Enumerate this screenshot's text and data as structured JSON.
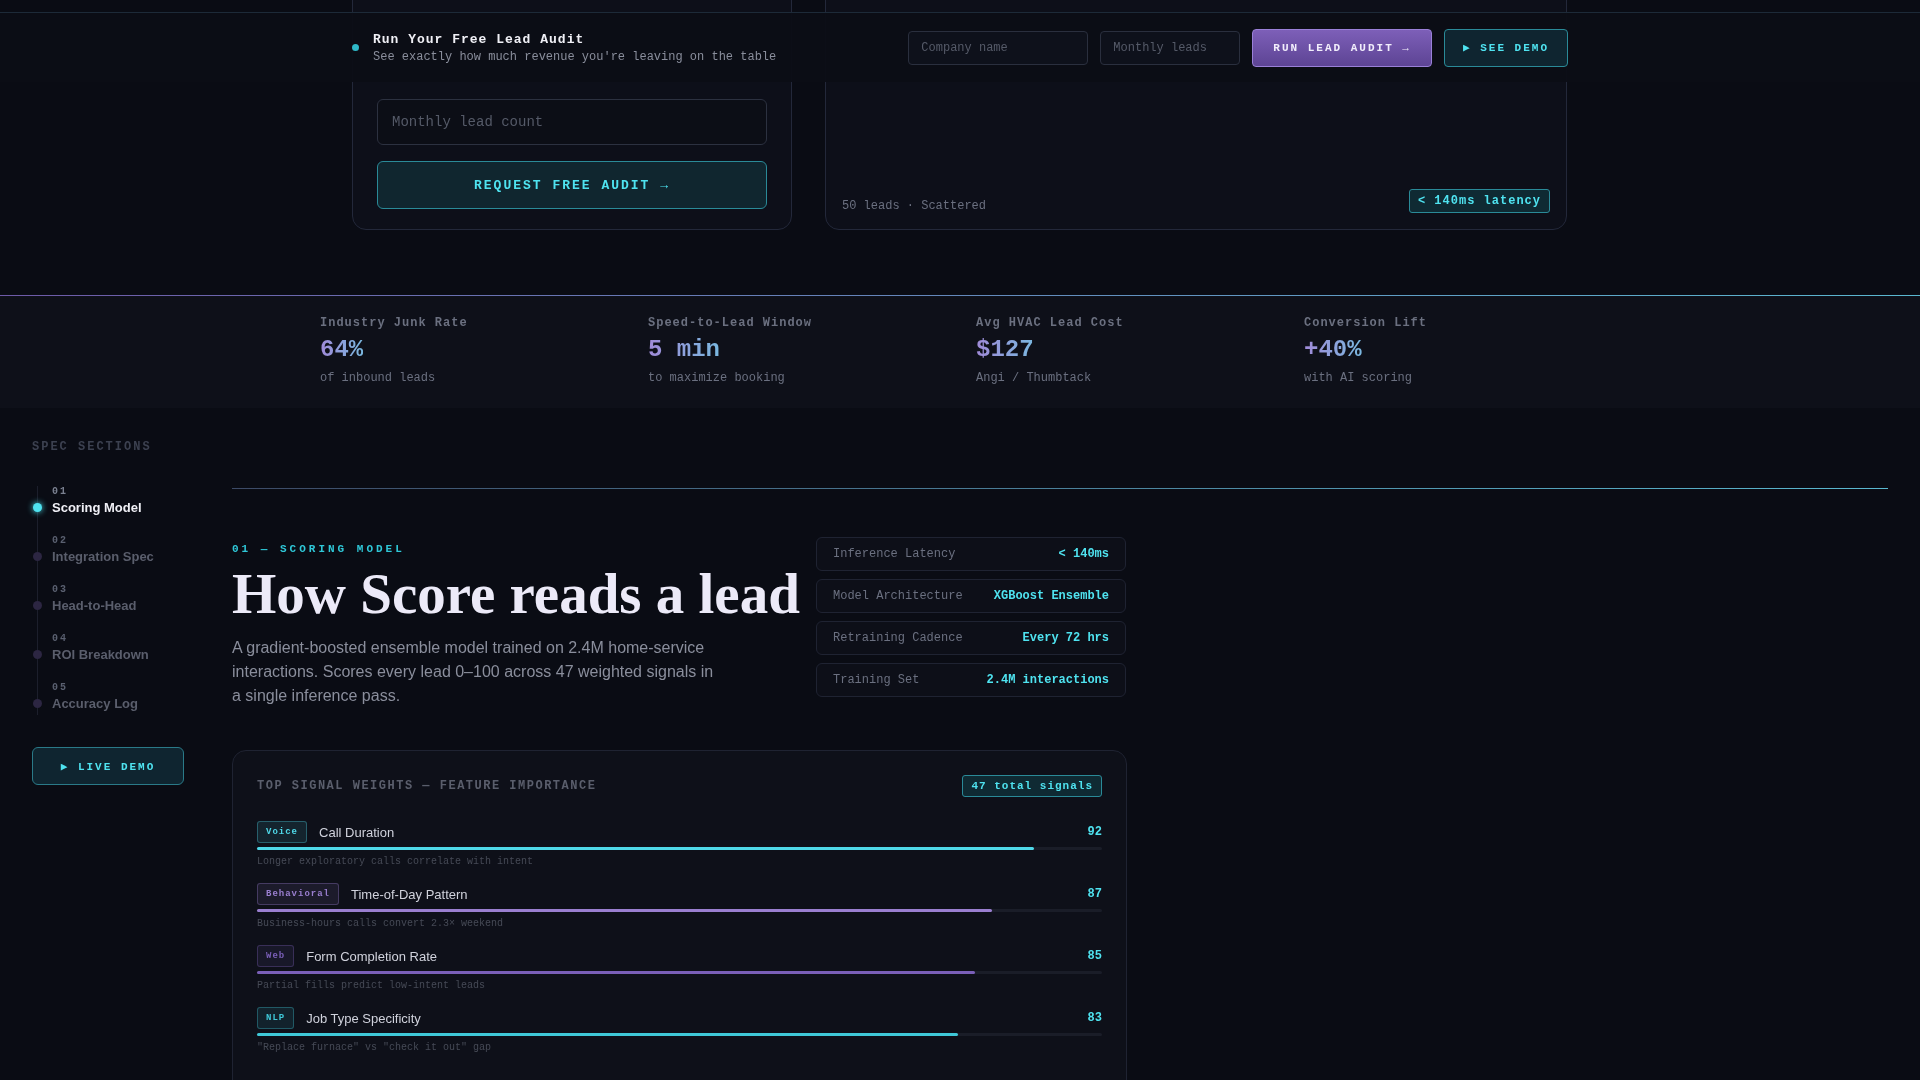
{
  "top_bar": {
    "title": "Run Your Free Lead Audit",
    "subtitle": "See exactly how much revenue you're leaving on the table",
    "fields": [
      {
        "placeholder": "Company name"
      },
      {
        "placeholder": "Monthly leads"
      }
    ],
    "primary_button": "RUN LEAD AUDIT →",
    "secondary_button": "▶ SEE DEMO"
  },
  "audit_card": {
    "field": {
      "placeholder": "Monthly lead count"
    },
    "button": "REQUEST FREE AUDIT →"
  },
  "preview_card": {
    "caption": "50 leads · Scattered",
    "badge": "< 140ms latency"
  },
  "stats": [
    {
      "label": "Industry Junk Rate",
      "value": "64%",
      "note": "of inbound leads"
    },
    {
      "label": "Speed-to-Lead Window",
      "value": "5 min",
      "note": "to maximize booking"
    },
    {
      "label": "Avg HVAC Lead Cost",
      "value": "$127",
      "note": "Angi / Thumbtack"
    },
    {
      "label": "Conversion Lift",
      "value": "+40%",
      "note": "with AI scoring"
    }
  ],
  "sidebar": {
    "title": "SPEC SECTIONS",
    "items": [
      {
        "number": "01",
        "label": "Scoring Model",
        "selected": true
      },
      {
        "number": "02",
        "label": "Integration Spec",
        "selected": false
      },
      {
        "number": "03",
        "label": "Head-to-Head",
        "selected": false
      },
      {
        "number": "04",
        "label": "ROI Breakdown",
        "selected": false
      },
      {
        "number": "05",
        "label": "Accuracy Log",
        "selected": false
      }
    ],
    "button": "▶ LIVE DEMO"
  },
  "section": {
    "eyebrow": "01 — SCORING MODEL",
    "heading": "How Score reads a lead",
    "description": "A gradient-boosted ensemble model trained on 2.4M home-service interactions. Scores every lead 0–100 across 47 weighted signals in a single inference pass.",
    "specs": [
      {
        "label": "Inference Latency",
        "value": "< 140ms"
      },
      {
        "label": "Model Architecture",
        "value": "XGBoost Ensemble"
      },
      {
        "label": "Retraining Cadence",
        "value": "Every 72 hrs"
      },
      {
        "label": "Training Set",
        "value": "2.4M interactions"
      }
    ]
  },
  "signals": {
    "title": "TOP SIGNAL WEIGHTS — FEATURE IMPORTANCE",
    "badge": "47 total signals",
    "items": [
      {
        "tag": "Voice",
        "name": "Call Duration",
        "score": "92",
        "level": 0.92,
        "color": "#4fd8e8",
        "note": "Longer exploratory calls correlate with intent"
      },
      {
        "tag": "Behavioral",
        "name": "Time-of-Day Pattern",
        "score": "87",
        "level": 0.87,
        "color": "#9a7fd0",
        "note": "Business-hours calls convert 2.3× weekend"
      },
      {
        "tag": "Web",
        "name": "Form Completion Rate",
        "score": "85",
        "level": 0.85,
        "color": "#7a5fb8",
        "note": "Partial fills predict low-intent leads"
      },
      {
        "tag": "NLP",
        "name": "Job Type Specificity",
        "score": "83",
        "level": 0.83,
        "color": "#3fc8d8",
        "note": "\"Replace furnace\" vs \"check it out\" gap"
      }
    ]
  }
}
